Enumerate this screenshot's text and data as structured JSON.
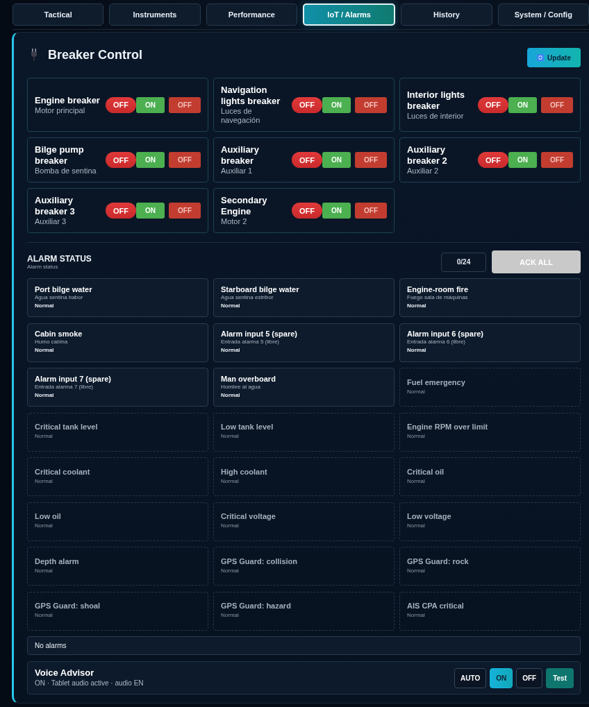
{
  "tabs": [
    {
      "label": "Tactical",
      "selected": false
    },
    {
      "label": "Instruments",
      "selected": false
    },
    {
      "label": "Performance",
      "selected": false
    },
    {
      "label": "IoT / Alarms",
      "selected": true
    },
    {
      "label": "History",
      "selected": false
    },
    {
      "label": "System / Config",
      "selected": false
    }
  ],
  "breaker_panel": {
    "title": "Breaker Control",
    "update_button": "Update",
    "breakers": [
      {
        "name": "Engine breaker",
        "sub": "Motor principal",
        "status": "OFF",
        "on": false,
        "on_label": "ON",
        "off_label": "OFF"
      },
      {
        "name": "Navigation lights breaker",
        "sub": "Luces de navegación",
        "status": "OFF",
        "on": false,
        "on_label": "ON",
        "off_label": "OFF"
      },
      {
        "name": "Interior lights breaker",
        "sub": "Luces de interior",
        "status": "OFF",
        "on": false,
        "on_label": "ON",
        "off_label": "OFF"
      },
      {
        "name": "Bilge pump breaker",
        "sub": "Bomba de sentina",
        "status": "OFF",
        "on": false,
        "on_label": "ON",
        "off_label": "OFF"
      },
      {
        "name": "Auxiliary breaker",
        "sub": "Auxiliar 1",
        "status": "OFF",
        "on": false,
        "on_label": "ON",
        "off_label": "OFF"
      },
      {
        "name": "Auxiliary breaker 2",
        "sub": "Auxiliar 2",
        "status": "OFF",
        "on": false,
        "on_label": "ON",
        "off_label": "OFF"
      },
      {
        "name": "Auxiliary breaker 3",
        "sub": "Auxiliar 3",
        "status": "OFF",
        "on": false,
        "on_label": "ON",
        "off_label": "OFF"
      },
      {
        "name": "Secondary Engine",
        "sub": "Motor 2",
        "status": "OFF",
        "on": false,
        "on_label": "ON",
        "off_label": "OFF"
      }
    ]
  },
  "alarm_status": {
    "title": "ALARM STATUS",
    "subtitle": "Alarm status",
    "count": "0/24",
    "ack_button": {
      "label": "ACK ALL",
      "disabled": true
    },
    "alarms": [
      {
        "name": "Port bilge water",
        "sub": "Agua sentina babor",
        "status": "Normal",
        "enabled": true
      },
      {
        "name": "Starboard bilge water",
        "sub": "Agua sentina estribor",
        "status": "Normal",
        "enabled": true
      },
      {
        "name": "Engine-room fire",
        "sub": "Fuego sala de máquinas",
        "status": "Normal",
        "enabled": true
      },
      {
        "name": "Cabin smoke",
        "sub": "Humo cabina",
        "status": "Normal",
        "enabled": true
      },
      {
        "name": "Alarm input 5 (spare)",
        "sub": "Entrada alarma 5 (libre)",
        "status": "Normal",
        "enabled": true
      },
      {
        "name": "Alarm input 6 (spare)",
        "sub": "Entrada alarma 6 (libre)",
        "status": "Normal",
        "enabled": true
      },
      {
        "name": "Alarm input 7 (spare)",
        "sub": "Entrada alarma 7 (libre)",
        "status": "Normal",
        "enabled": true
      },
      {
        "name": "Man overboard",
        "sub": "Hombre al agua",
        "status": "Normal",
        "enabled": true
      },
      {
        "name": "Fuel emergency",
        "status": "Normal",
        "enabled": false
      },
      {
        "name": "Critical tank level",
        "status": "Normal",
        "enabled": false
      },
      {
        "name": "Low tank level",
        "status": "Normal",
        "enabled": false
      },
      {
        "name": "Engine RPM over limit",
        "status": "Normal",
        "enabled": false
      },
      {
        "name": "Critical coolant",
        "status": "Normal",
        "enabled": false
      },
      {
        "name": "High coolant",
        "status": "Normal",
        "enabled": false
      },
      {
        "name": "Critical oil",
        "status": "Normal",
        "enabled": false
      },
      {
        "name": "Low oil",
        "status": "Normal",
        "enabled": false
      },
      {
        "name": "Critical voltage",
        "status": "Normal",
        "enabled": false
      },
      {
        "name": "Low voltage",
        "status": "Normal",
        "enabled": false
      },
      {
        "name": "Depth alarm",
        "status": "Normal",
        "enabled": false
      },
      {
        "name": "GPS Guard: collision",
        "status": "Normal",
        "enabled": false
      },
      {
        "name": "GPS Guard: rock",
        "status": "Normal",
        "enabled": false
      },
      {
        "name": "GPS Guard: shoal",
        "status": "Normal",
        "enabled": false
      },
      {
        "name": "GPS Guard: hazard",
        "status": "Normal",
        "enabled": false
      },
      {
        "name": "AIS CPA critical",
        "status": "Normal",
        "enabled": false
      }
    ],
    "summary": "No alarms"
  },
  "voice_advisor": {
    "title": "Voice Advisor",
    "status": "ON · Tablet audio active · audio EN",
    "modes": [
      {
        "label": "AUTO",
        "selected": false
      },
      {
        "label": "ON",
        "selected": true
      },
      {
        "label": "OFF",
        "selected": false
      }
    ],
    "test_button": "Test"
  }
}
